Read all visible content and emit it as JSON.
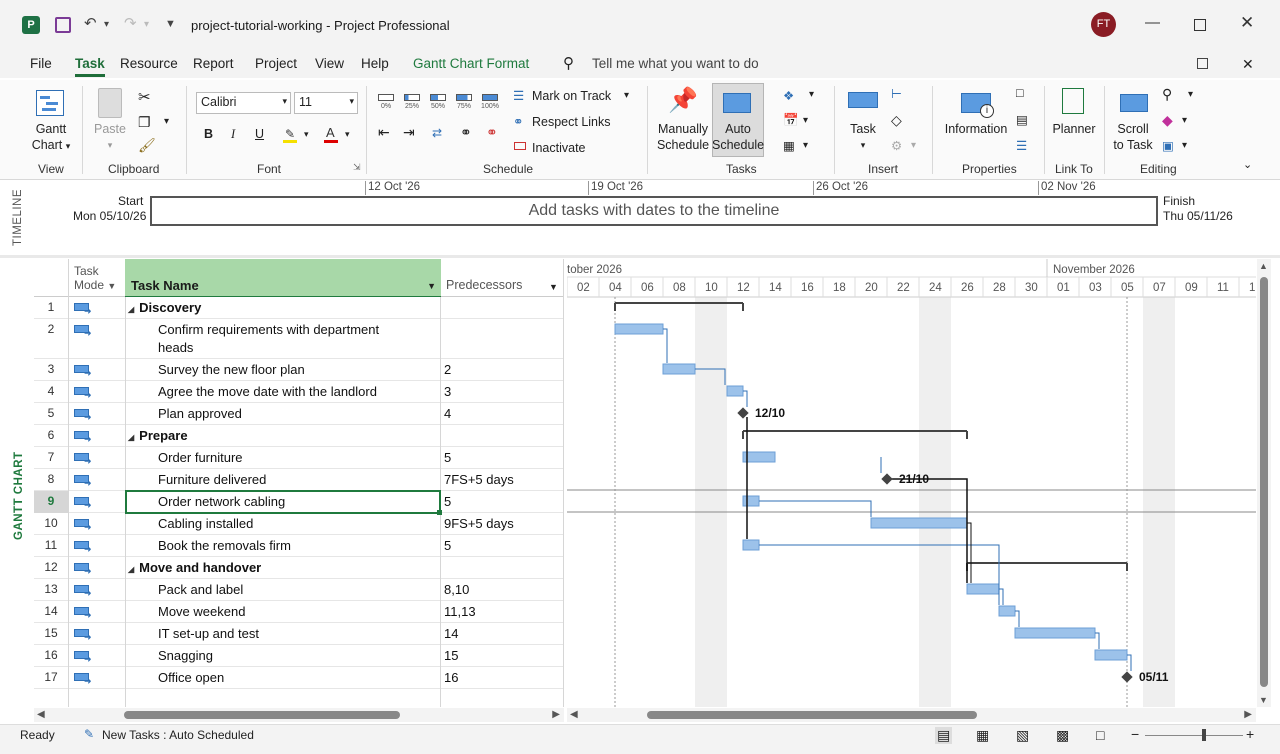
{
  "window": {
    "title": "project-tutorial-working - Project Professional",
    "user_initials": "FT"
  },
  "menu": {
    "items": [
      "File",
      "Task",
      "Resource",
      "Report",
      "Project",
      "View",
      "Help"
    ],
    "format": "Gantt Chart Format",
    "tell_me": "Tell me what you want to do"
  },
  "ribbon": {
    "view": {
      "gantt_label": "Gantt",
      "gantt_label2": "Chart",
      "group": "View"
    },
    "clipboard": {
      "paste": "Paste",
      "group": "Clipboard"
    },
    "font": {
      "name": "Calibri",
      "size": "11",
      "bold": "B",
      "italic": "I",
      "underline": "U",
      "group": "Font"
    },
    "schedule": {
      "mark_on_track": "Mark on Track",
      "respect_links": "Respect Links",
      "inactivate": "Inactivate",
      "group": "Schedule",
      "pcts": [
        "0%",
        "25%",
        "50%",
        "75%",
        "100%"
      ]
    },
    "tasks": {
      "manual": "Manually",
      "manual2": "Schedule",
      "auto": "Auto",
      "auto2": "Schedule",
      "group": "Tasks"
    },
    "insert": {
      "task": "Task",
      "group": "Insert"
    },
    "properties": {
      "information": "Information",
      "group": "Properties"
    },
    "linkto": {
      "planner": "Planner",
      "group": "Link To"
    },
    "editing": {
      "scroll": "Scroll",
      "scroll2": "to Task",
      "group": "Editing"
    }
  },
  "timeline": {
    "label": "TIMELINE",
    "start_label": "Start",
    "start_date": "Mon 05/10/26",
    "finish_label": "Finish",
    "finish_date": "Thu 05/11/26",
    "placeholder": "Add tasks with dates to the timeline",
    "dates": [
      "12 Oct '26",
      "19 Oct '26",
      "26 Oct '26",
      "02 Nov '26"
    ]
  },
  "grid": {
    "side_label": "GANTT CHART",
    "headers": {
      "mode": "Task",
      "mode2": "Mode",
      "name": "Task Name",
      "pred": "Predecessors"
    },
    "rows": [
      {
        "id": "1",
        "name": "Discovery",
        "pred": "",
        "summary": true
      },
      {
        "id": "2",
        "name": "Confirm requirements with department",
        "name2": "heads",
        "pred": ""
      },
      {
        "id": "3",
        "name": "Survey the new floor plan",
        "pred": "2"
      },
      {
        "id": "4",
        "name": "Agree the move date with the landlord",
        "pred": "3"
      },
      {
        "id": "5",
        "name": "Plan approved",
        "pred": "4"
      },
      {
        "id": "6",
        "name": "Prepare",
        "pred": "",
        "summary": true
      },
      {
        "id": "7",
        "name": "Order furniture",
        "pred": "5"
      },
      {
        "id": "8",
        "name": "Furniture delivered",
        "pred": "7FS+5 days"
      },
      {
        "id": "9",
        "name": "Order network cabling",
        "pred": "5"
      },
      {
        "id": "10",
        "name": "Cabling installed",
        "pred": "9FS+5 days"
      },
      {
        "id": "11",
        "name": "Book the removals firm",
        "pred": "5"
      },
      {
        "id": "12",
        "name": "Move and handover",
        "pred": "",
        "summary": true
      },
      {
        "id": "13",
        "name": "Pack and label",
        "pred": "8,10"
      },
      {
        "id": "14",
        "name": "Move weekend",
        "pred": "11,13"
      },
      {
        "id": "15",
        "name": "IT set-up and test",
        "pred": "14"
      },
      {
        "id": "16",
        "name": "Snagging",
        "pred": "15"
      },
      {
        "id": "17",
        "name": "Office open",
        "pred": "16"
      }
    ]
  },
  "gantt": {
    "month1": "tober 2026",
    "month2": "November 2026",
    "days": [
      "02",
      "04",
      "06",
      "08",
      "10",
      "12",
      "14",
      "16",
      "18",
      "20",
      "22",
      "24",
      "26",
      "28",
      "30",
      "01",
      "03",
      "05",
      "07",
      "09",
      "11",
      "1"
    ],
    "milestones": [
      "12/10",
      "21/10",
      "05/11"
    ]
  },
  "status": {
    "ready": "Ready",
    "new_tasks": "New Tasks : Auto Scheduled"
  }
}
